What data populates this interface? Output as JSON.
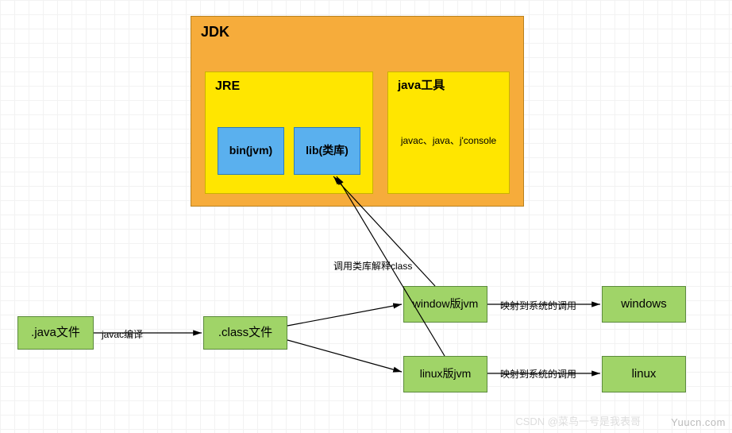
{
  "jdk": {
    "title": "JDK"
  },
  "jre": {
    "title": "JRE",
    "bin": "bin(jvm)",
    "lib": "lib(类库)"
  },
  "tools": {
    "title": "java工具",
    "items": "javac、java、j'console"
  },
  "nodes": {
    "javaFile": ".java文件",
    "classFile": ".class文件",
    "winJvm": "window版jvm",
    "linuxJvm": "linux版jvm",
    "windows": "windows",
    "linux": "linux"
  },
  "labels": {
    "javac": "javac编译",
    "callLib": "调用类库解释class",
    "mapWin": "映射到系统的调用",
    "mapLinux": "映射到系统的调用"
  },
  "watermark": "Yuucn.com",
  "watermark2": "CSDN @菜鸟一号是我表哥"
}
